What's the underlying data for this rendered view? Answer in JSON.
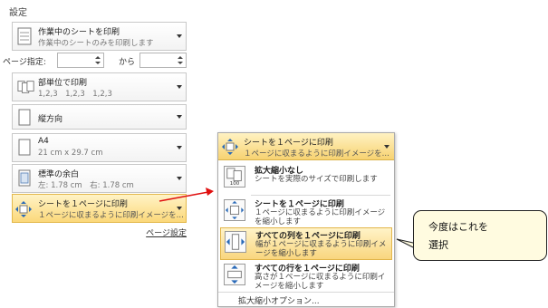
{
  "panel": {
    "title": "設定",
    "print_target": {
      "line1": "作業中のシートを印刷",
      "line2": "作業中のシートのみを印刷します"
    },
    "pages": {
      "label": "ページ指定:",
      "from_value": "",
      "to_label": "から",
      "to_value": ""
    },
    "collate": {
      "line1": "部単位で印刷",
      "line2": "1,2,3　1,2,3　1,2,3"
    },
    "orientation": {
      "line1": "縦方向"
    },
    "paper": {
      "line1": "A4",
      "line2": "21 cm x 29.7 cm"
    },
    "margins": {
      "line1": "標準の余白",
      "line2": "左:  1.78 cm　右:  1.78 cm"
    },
    "scaling": {
      "line1": "シートを１ページに印刷",
      "line2": "１ページに収まるように印刷イメージを..."
    },
    "page_setup_link": "ページ設定"
  },
  "dropdown": {
    "header": {
      "line1": "シートを１ページに印刷",
      "line2": "１ページに収まるように印刷イメージを..."
    },
    "items": [
      {
        "title": "拡大縮小なし",
        "desc": "シートを実際のサイズで印刷します",
        "icon_text": "100"
      },
      {
        "title": "シートを１ページに印刷",
        "desc": "１ページに収まるように印刷イメージを縮小します"
      },
      {
        "title": "すべての列を１ページに印刷",
        "desc": "幅が１ページに収まるように印刷イメージを縮小します"
      },
      {
        "title": "すべての行を１ページに印刷",
        "desc": "高さが１ページに収まるように印刷イメージを縮小します"
      }
    ],
    "footer": "拡大縮小オプション..."
  },
  "callout": {
    "line1": "今度はこれを",
    "line2": "選択"
  },
  "colors": {
    "highlight_top": "#fff3c8",
    "highlight_bottom": "#f9d67e",
    "arrow": "#e01010"
  }
}
